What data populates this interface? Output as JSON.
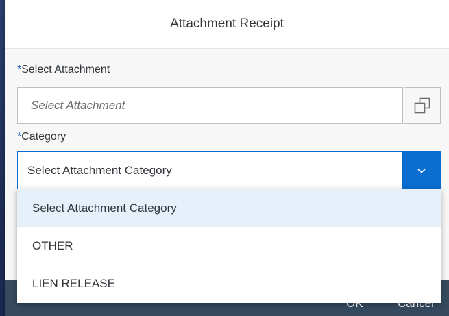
{
  "dialog": {
    "title": "Attachment Receipt"
  },
  "form": {
    "required_marker": "*",
    "attachment": {
      "label": "Select Attachment",
      "placeholder": "Select Attachment",
      "browse_icon": "browse-window-icon"
    },
    "category": {
      "label": "Category",
      "selected_value": "Select Attachment Category",
      "dropdown_icon": "chevron-down-icon"
    }
  },
  "dropdown": {
    "options": [
      {
        "label": "Select Attachment Category",
        "selected": true
      },
      {
        "label": "OTHER",
        "selected": false
      },
      {
        "label": "LIEN RELEASE",
        "selected": false
      }
    ]
  },
  "footer": {
    "ok_label": "OK",
    "cancel_label": "Cancel"
  },
  "colors": {
    "accent": "#0a6ed1",
    "required": "#1556b8",
    "footer_bg": "#354a5f",
    "selected_option_bg": "#e5f0fa"
  }
}
